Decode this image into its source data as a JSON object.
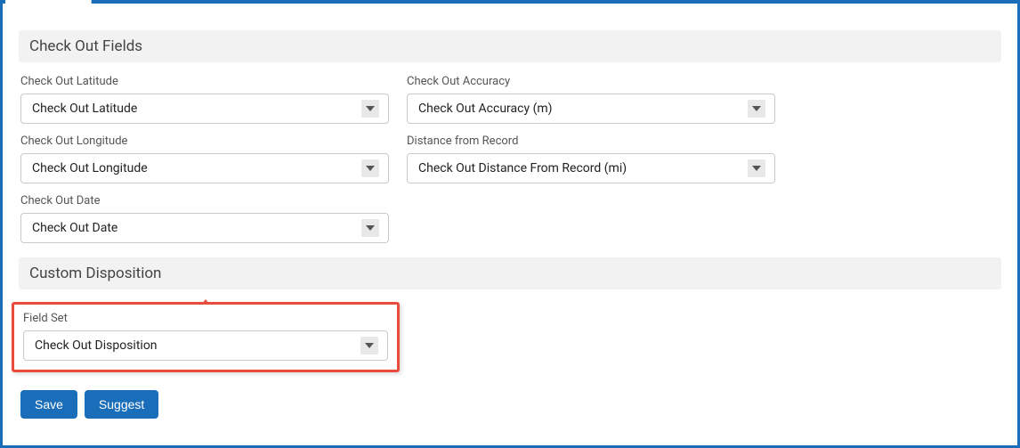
{
  "sections": {
    "checkOutFields": {
      "title": "Check Out Fields",
      "fields": {
        "latitude": {
          "label": "Check Out Latitude",
          "value": "Check Out Latitude"
        },
        "accuracy": {
          "label": "Check Out Accuracy",
          "value": "Check Out Accuracy (m)"
        },
        "longitude": {
          "label": "Check Out Longitude",
          "value": "Check Out Longitude"
        },
        "distance": {
          "label": "Distance from Record",
          "value": "Check Out Distance From Record (mi)"
        },
        "date": {
          "label": "Check Out Date",
          "value": "Check Out Date"
        }
      }
    },
    "customDisposition": {
      "title": "Custom Disposition",
      "fields": {
        "fieldSet": {
          "label": "Field Set",
          "value": "Check Out Disposition"
        }
      }
    }
  },
  "buttons": {
    "save": "Save",
    "suggest": "Suggest"
  }
}
